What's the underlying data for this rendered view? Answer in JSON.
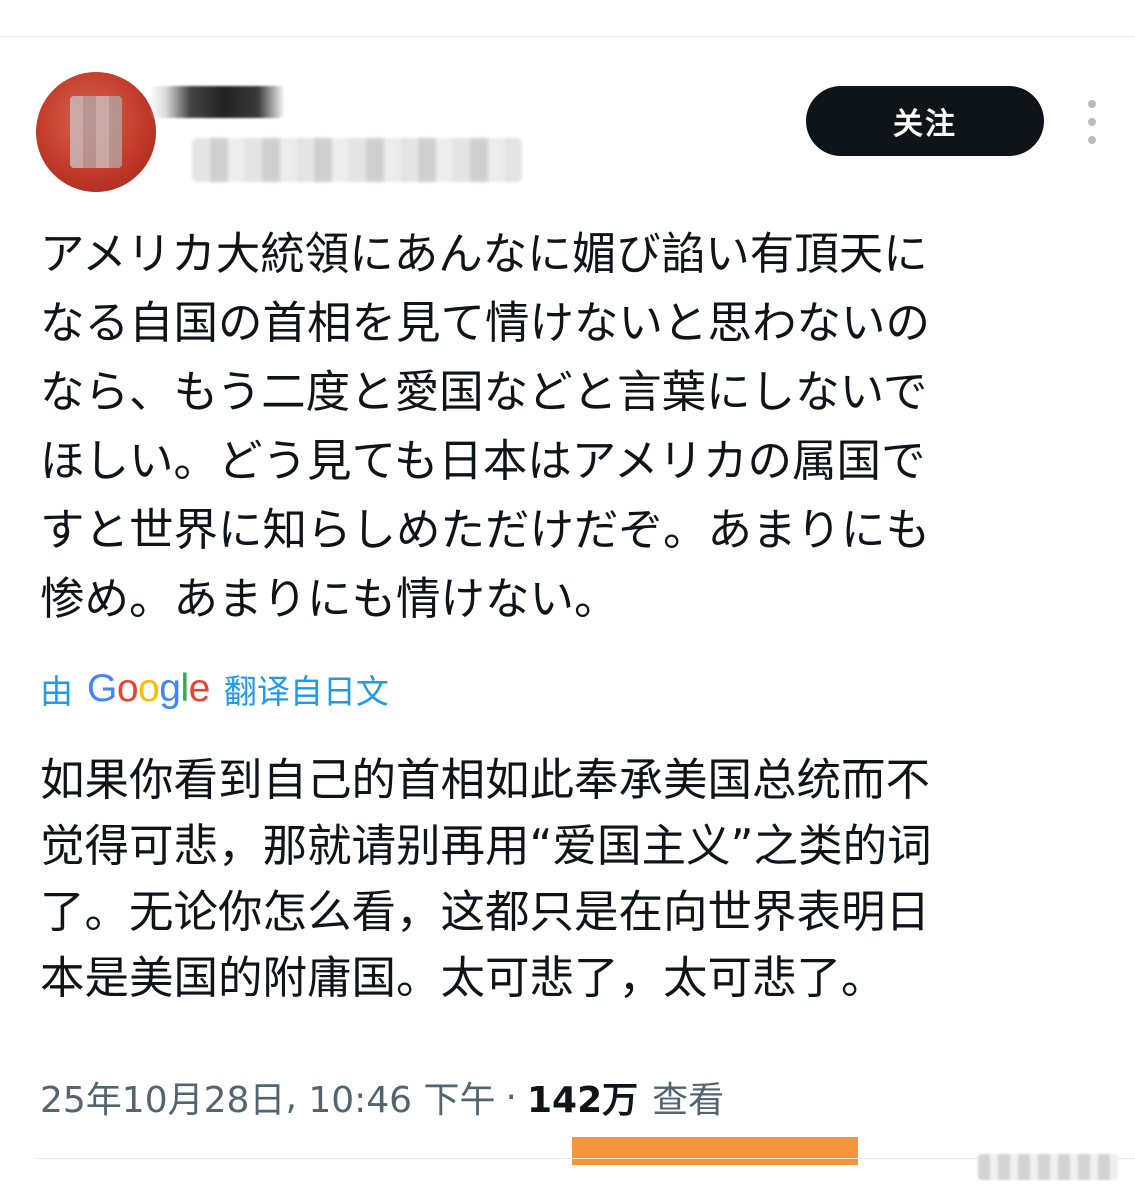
{
  "follow_button": {
    "label": "关注"
  },
  "tweet": {
    "text_lines": [
      "アメリカ大統領にあんなに媚び諂い有頂天に",
      "なる自国の首相を見て情けないと思わないの",
      "なら、もう二度と愛国などと言葉にしないで",
      "ほしい。どう見ても日本はアメリカの属国で",
      "すと世界に知らしめただけだぞ。あまりにも",
      "惨め。あまりにも情けない。"
    ],
    "text": "アメリカ大統領にあんなに媚び諂い有頂天に\nなる自国の首相を見て情けないと思わないの\nなら、もう二度と愛国などと言葉にしないで\nほしい。どう見ても日本はアメリカの属国で\nすと世界に知らしめただけだぞ。あまりにも\n惨め。あまりにも情けない。"
  },
  "translation": {
    "prefix": "由",
    "provider_letters": [
      "G",
      "o",
      "o",
      "g",
      "l",
      "e"
    ],
    "suffix": "翻译自日文",
    "text": "如果你看到自己的首相如此奉承美国总统而不\n觉得可悲，那就请别再用“爱国主义”之类的词\n了。无论你怎么看，这都只是在向世界表明日\n本是美国的附庸国。太可悲了，太可悲了。"
  },
  "meta": {
    "date": "25年10月28日",
    "time": "10:46 下午",
    "separator": "·",
    "views_count": "142万",
    "views_label": "查看"
  },
  "colors": {
    "accent": "#1d9bf0",
    "follow_bg": "#0f1419",
    "highlight_bar": "#f5953b",
    "secondary_text": "#536471"
  },
  "icons": {
    "more": "more-vertical-icon",
    "provider_logo": "google-logo-icon"
  }
}
